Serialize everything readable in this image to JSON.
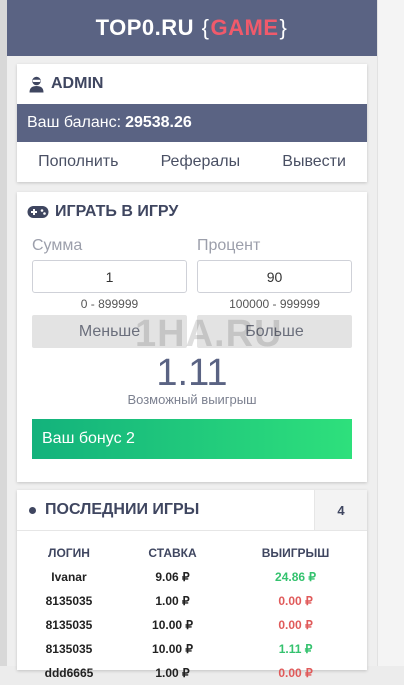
{
  "header": {
    "brand": "TOP0.RU",
    "open_brace": "{",
    "game": "GAME",
    "close_brace": "}"
  },
  "account": {
    "username": "ADMIN",
    "balance_label": "Ваш баланс:",
    "balance_value": "29538.26",
    "actions": [
      "Пополнить",
      "Рефералы",
      "Вывести"
    ]
  },
  "game": {
    "title": "ИГРАТЬ В ИГРУ",
    "sum_label": "Сумма",
    "sum_value": "1",
    "sum_range": "0 - 899999",
    "percent_label": "Процент",
    "percent_value": "90",
    "percent_range": "100000 - 999999",
    "less_button": "Меньше",
    "more_button": "Больше",
    "possible_win": "1.11",
    "possible_win_caption": "Возможный выигрыш",
    "bonus_text": "Ваш бонус 2"
  },
  "last_games": {
    "title": "ПОСЛЕДНИИ ИГРЫ",
    "count": "4",
    "columns": [
      "ЛОГИН",
      "СТАВКА",
      "ВЫИГРЫШ"
    ],
    "rows": [
      {
        "login": "Ivanar",
        "bet": "9.06 ₽",
        "win": "24.86 ₽",
        "status": "win"
      },
      {
        "login": "8135035",
        "bet": "1.00 ₽",
        "win": "0.00 ₽",
        "status": "lose"
      },
      {
        "login": "8135035",
        "bet": "10.00 ₽",
        "win": "0.00 ₽",
        "status": "lose"
      },
      {
        "login": "8135035",
        "bet": "10.00 ₽",
        "win": "1.11 ₽",
        "status": "win"
      },
      {
        "login": "ddd6665",
        "bet": "1.00 ₽",
        "win": "0.00 ₽",
        "status": "lose"
      }
    ]
  },
  "watermark": "1HA.RU",
  "colors": {
    "header": "#5a6383",
    "accent": "#f05a6b",
    "win": "#34c26e",
    "lose": "#e05a5a",
    "bonus": "#13b27c"
  },
  "icons": {
    "user": "user-ninja-icon",
    "game": "gamepad-icon",
    "last": "bullet-icon"
  }
}
